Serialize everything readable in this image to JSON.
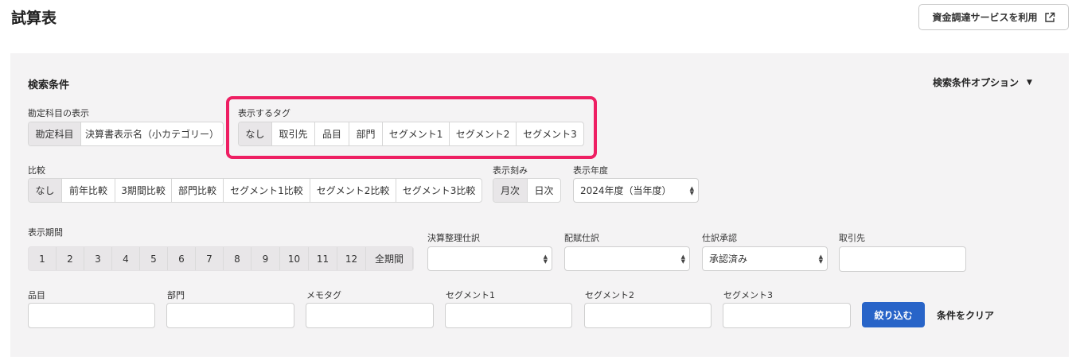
{
  "page": {
    "title": "試算表"
  },
  "external_button": {
    "label": "資金調達サービスを利用"
  },
  "search": {
    "title": "検索条件",
    "options_toggle": "検索条件オプション",
    "account_display": {
      "label": "勘定科目の表示",
      "options": [
        "勘定科目",
        "決算書表示名（小カテゴリー）"
      ],
      "selected": 0
    },
    "display_tag": {
      "label": "表示するタグ",
      "options": [
        "なし",
        "取引先",
        "品目",
        "部門",
        "セグメント1",
        "セグメント2",
        "セグメント3"
      ],
      "selected": 0
    },
    "comparison": {
      "label": "比較",
      "options": [
        "なし",
        "前年比較",
        "3期間比較",
        "部門比較",
        "セグメント1比較",
        "セグメント2比較",
        "セグメント3比較"
      ],
      "selected": 0
    },
    "interval": {
      "label": "表示刻み",
      "options": [
        "月次",
        "日次"
      ],
      "selected": 0
    },
    "fiscal_year": {
      "label": "表示年度",
      "value": "2024年度（当年度）"
    },
    "period": {
      "label": "表示期間",
      "options": [
        "1",
        "2",
        "3",
        "4",
        "5",
        "6",
        "7",
        "8",
        "9",
        "10",
        "11",
        "12",
        "全期間"
      ]
    },
    "closing_entries": {
      "label": "決算整理仕訳",
      "value": ""
    },
    "allocation_entries": {
      "label": "配賦仕訳",
      "value": ""
    },
    "approval": {
      "label": "仕訳承認",
      "value": "承認済み"
    },
    "partner": {
      "label": "取引先",
      "value": ""
    },
    "item": {
      "label": "品目",
      "value": ""
    },
    "department": {
      "label": "部門",
      "value": ""
    },
    "memo_tag": {
      "label": "メモタグ",
      "value": ""
    },
    "segment1": {
      "label": "セグメント1",
      "value": ""
    },
    "segment2": {
      "label": "セグメント2",
      "value": ""
    },
    "segment3": {
      "label": "セグメント3",
      "value": ""
    },
    "filter_button": "絞り込む",
    "clear_button": "条件をクリア"
  },
  "colors": {
    "accent": "#2864c8",
    "highlight": "#ee1f63",
    "panel": "#f4f3f4"
  }
}
